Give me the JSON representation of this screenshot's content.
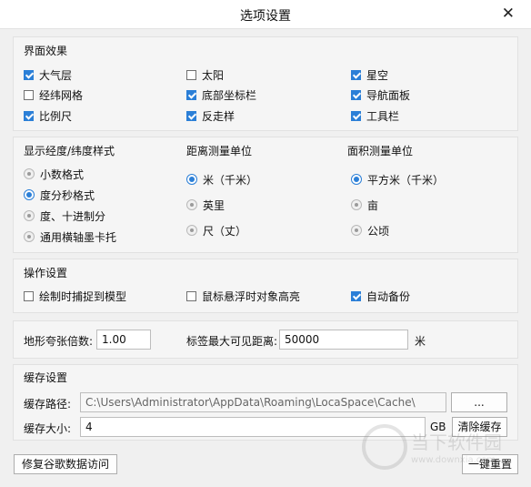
{
  "window": {
    "title": "选项设置",
    "close": "✕"
  },
  "display_effects": {
    "title": "界面效果",
    "items": [
      {
        "label": "大气层",
        "checked": true
      },
      {
        "label": "太阳",
        "checked": false
      },
      {
        "label": "星空",
        "checked": true
      },
      {
        "label": "经纬网格",
        "checked": false
      },
      {
        "label": "底部坐标栏",
        "checked": true
      },
      {
        "label": "导航面板",
        "checked": true
      },
      {
        "label": "比例尺",
        "checked": true
      },
      {
        "label": "反走样",
        "checked": true
      },
      {
        "label": "工具栏",
        "checked": true
      }
    ]
  },
  "lonlat_format": {
    "title": "显示经度/纬度样式",
    "options": [
      {
        "label": "小数格式",
        "selected": false
      },
      {
        "label": "度分秒格式",
        "selected": true
      },
      {
        "label": "度、十进制分",
        "selected": false
      },
      {
        "label": "通用横轴墨卡托",
        "selected": false
      }
    ]
  },
  "distance_unit": {
    "title": "距离测量单位",
    "options": [
      {
        "label": "米（千米）",
        "selected": true
      },
      {
        "label": "英里",
        "selected": false
      },
      {
        "label": "尺（丈）",
        "selected": false
      }
    ]
  },
  "area_unit": {
    "title": "面积测量单位",
    "options": [
      {
        "label": "平方米（千米）",
        "selected": true
      },
      {
        "label": "亩",
        "selected": false
      },
      {
        "label": "公顷",
        "selected": false
      }
    ]
  },
  "operation": {
    "title": "操作设置",
    "items": [
      {
        "label": "绘制时捕捉到模型",
        "checked": false
      },
      {
        "label": "鼠标悬浮时对象高亮",
        "checked": false
      },
      {
        "label": "自动备份",
        "checked": true
      }
    ]
  },
  "terrain": {
    "exaggeration_label": "地形夸张倍数:",
    "exaggeration_value": "1.00",
    "label_distance_label": "标签最大可见距离:",
    "label_distance_value": "50000",
    "label_distance_unit": "米"
  },
  "cache": {
    "title": "缓存设置",
    "path_label": "缓存路径:",
    "path_value": "C:\\Users\\Administrator\\AppData\\Roaming\\LocaSpace\\Cache\\",
    "browse_label": "...",
    "size_label": "缓存大小:",
    "size_value": "4",
    "size_unit": "GB",
    "clear_label": "清除缓存"
  },
  "footer": {
    "repair_label": "修复谷歌数据访问",
    "reset_label": "一键重置"
  },
  "watermark": {
    "text": "当下软件园",
    "url": "www.downxia.com"
  }
}
